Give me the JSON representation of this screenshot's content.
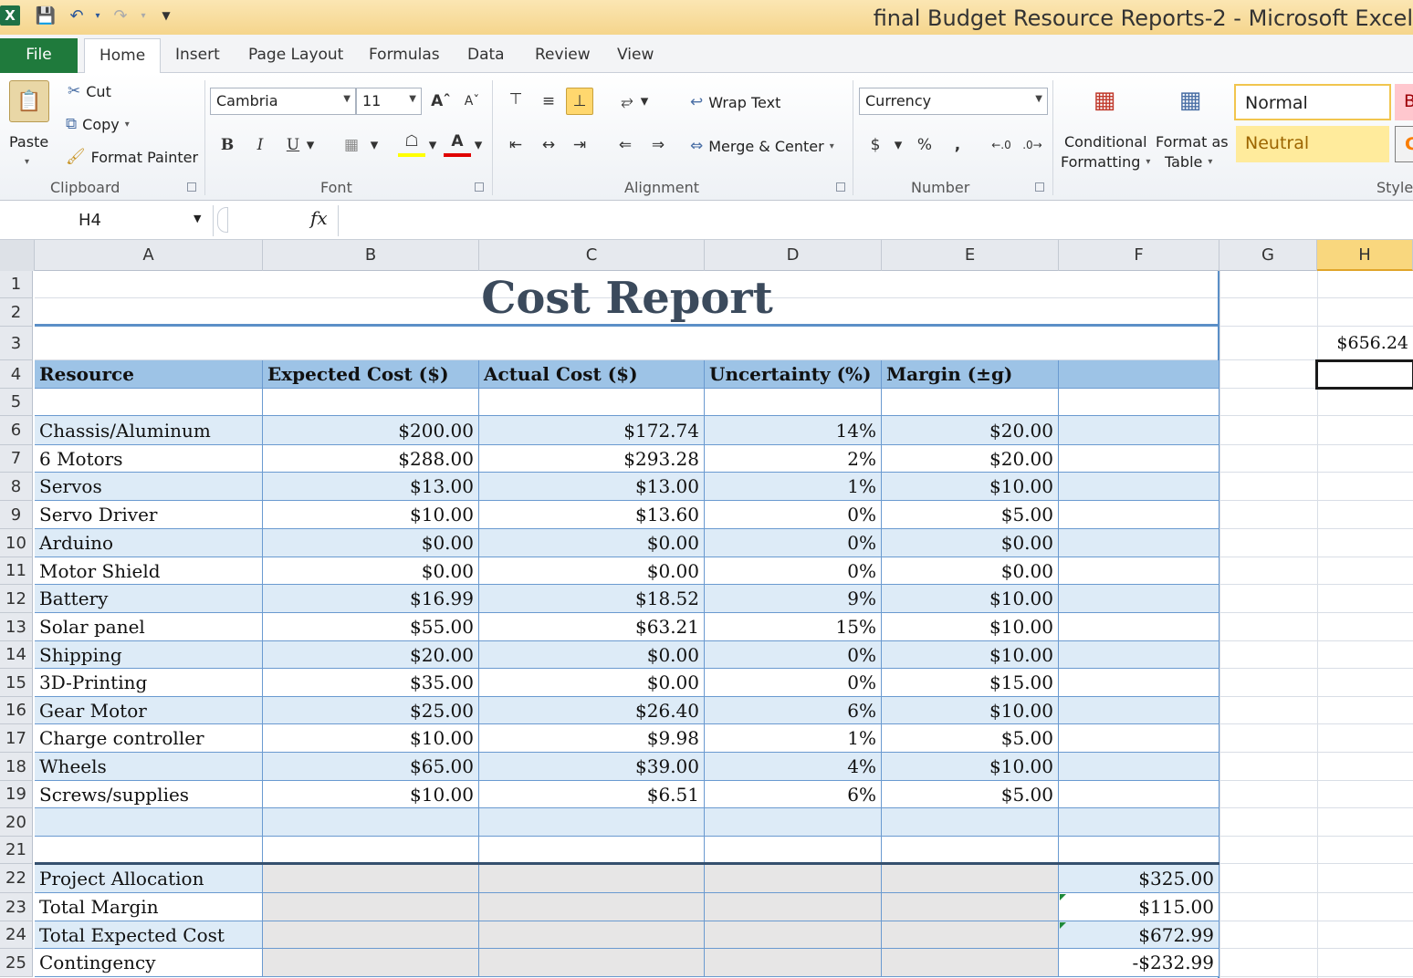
{
  "window": {
    "title": "final Budget Resource Reports-2  -  Microsoft Excel"
  },
  "quick_access": {
    "logo": "X",
    "save_icon": "save-icon",
    "undo_icon": "undo-icon",
    "redo_icon": "redo-icon"
  },
  "tabs": [
    {
      "label": "File"
    },
    {
      "label": "Home"
    },
    {
      "label": "Insert"
    },
    {
      "label": "Page Layout"
    },
    {
      "label": "Formulas"
    },
    {
      "label": "Data"
    },
    {
      "label": "Review"
    },
    {
      "label": "View"
    }
  ],
  "ribbon": {
    "clipboard": {
      "paste": "Paste",
      "cut": "Cut",
      "copy": "Copy",
      "format_painter": "Format Painter",
      "group": "Clipboard"
    },
    "font": {
      "name": "Cambria",
      "size": "11",
      "bold": "B",
      "italic": "I",
      "underline": "U",
      "font_color_glyph": "A",
      "group": "Font"
    },
    "alignment": {
      "wrap_text": "Wrap Text",
      "merge_center": "Merge & Center",
      "group": "Alignment"
    },
    "number": {
      "format": "Currency",
      "currency": "$",
      "percent": "%",
      "comma": ",",
      "group": "Number"
    },
    "styles": {
      "conditional": [
        "Conditional",
        "Formatting"
      ],
      "format_table": [
        "Format as",
        "Table"
      ],
      "normal": "Normal",
      "neutral": "Neutral",
      "bad_partial": "B",
      "calc_partial": "C",
      "group": "Styles"
    }
  },
  "formula_bar": {
    "name_box": "H4",
    "fx": "fx",
    "content": ""
  },
  "sheet": {
    "columns": [
      "A",
      "B",
      "C",
      "D",
      "E",
      "F",
      "G",
      "H"
    ],
    "title": "Cost Report",
    "h3_value": "$656.24",
    "headers": [
      "Resource",
      "Expected Cost ($)",
      "Actual Cost ($)",
      "Uncertainty (%)",
      "Margin (±g)",
      ""
    ],
    "rows": [
      [
        "Chassis/Aluminum",
        "$200.00",
        "$172.74",
        "14%",
        "$20.00"
      ],
      [
        "6 Motors",
        "$288.00",
        "$293.28",
        "2%",
        "$20.00"
      ],
      [
        "Servos",
        "$13.00",
        "$13.00",
        "1%",
        "$10.00"
      ],
      [
        "Servo Driver",
        "$10.00",
        "$13.60",
        "0%",
        "$5.00"
      ],
      [
        "Arduino",
        "$0.00",
        "$0.00",
        "0%",
        "$0.00"
      ],
      [
        "Motor Shield",
        "$0.00",
        "$0.00",
        "0%",
        "$0.00"
      ],
      [
        "Battery",
        "$16.99",
        "$18.52",
        "9%",
        "$10.00"
      ],
      [
        "Solar panel",
        "$55.00",
        "$63.21",
        "15%",
        "$10.00"
      ],
      [
        "Shipping",
        "$20.00",
        "$0.00",
        "0%",
        "$10.00"
      ],
      [
        "3D-Printing",
        "$35.00",
        "$0.00",
        "0%",
        "$15.00"
      ],
      [
        "Gear Motor",
        "$25.00",
        "$26.40",
        "6%",
        "$10.00"
      ],
      [
        "Charge controller",
        "$10.00",
        "$9.98",
        "1%",
        "$5.00"
      ],
      [
        "Wheels",
        "$65.00",
        "$39.00",
        "4%",
        "$10.00"
      ],
      [
        "Screws/supplies",
        "$10.00",
        "$6.51",
        "6%",
        "$5.00"
      ]
    ],
    "summary": [
      [
        "Project Allocation",
        "$325.00"
      ],
      [
        "Total Margin",
        "$115.00"
      ],
      [
        "Total Expected Cost",
        "$672.99"
      ],
      [
        "Contingency",
        "-$232.99"
      ]
    ],
    "row_numbers": [
      "1",
      "2",
      "3",
      "4",
      "5",
      "6",
      "7",
      "8",
      "9",
      "10",
      "11",
      "12",
      "13",
      "14",
      "15",
      "16",
      "17",
      "18",
      "19",
      "20",
      "21",
      "22",
      "23",
      "24",
      "25"
    ],
    "colors": {
      "header_fill": "#9dc3e6",
      "band_fill": "#ddebf7",
      "gray_fill": "#e7e6e6",
      "border": "#6a9ad0"
    }
  }
}
